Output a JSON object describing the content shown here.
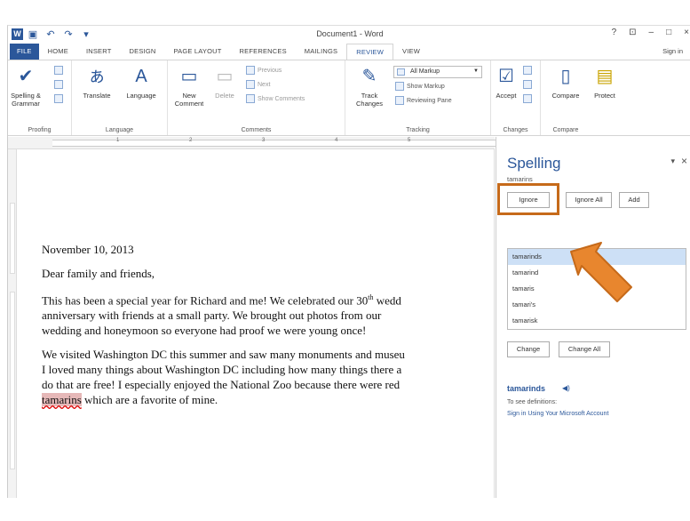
{
  "titlebar": {
    "qat_icons": [
      "save-icon",
      "undo-icon",
      "redo-icon",
      "customize-icon"
    ],
    "doc_title": "Document1 - Word",
    "window_controls": [
      "?",
      "⊡",
      "–",
      "□",
      "×"
    ]
  },
  "tabs": [
    "FILE",
    "HOME",
    "INSERT",
    "DESIGN",
    "PAGE LAYOUT",
    "REFERENCES",
    "MAILINGS",
    "REVIEW",
    "VIEW"
  ],
  "active_tab": "REVIEW",
  "signin": "Sign in",
  "ribbon": {
    "proofing": {
      "label": "Proofing",
      "spelling": "Spelling &",
      "grammar": "Grammar"
    },
    "language": {
      "label": "Language",
      "translate": "Translate",
      "language": "Language"
    },
    "comments": {
      "label": "Comments",
      "new": "New",
      "comment": "Comment",
      "delete": "Delete",
      "previous": "Previous",
      "next": "Next",
      "show_comments": "Show Comments"
    },
    "tracking": {
      "label": "Tracking",
      "track": "Track",
      "changes": "Changes",
      "markup": "All Markup",
      "show_markup": "Show Markup",
      "reviewing_pane": "Reviewing Pane"
    },
    "changes": {
      "label": "Changes",
      "accept": "Accept"
    },
    "compare": {
      "label": "Compare",
      "compare": "Compare",
      "protect": "Protect"
    }
  },
  "ruler_numbers": [
    "1",
    "2",
    "3",
    "4",
    "5"
  ],
  "document": {
    "date": "November 10, 2013",
    "greeting": "Dear family and friends,",
    "para1_line1_pre": "This has been a special year for Richard and me! We celebrated our 30",
    "para1_sup": "th",
    "para1_line1_post": " wedd",
    "para1_line2": "anniversary with friends at a small party.  We brought out photos from our",
    "para1_line3": "wedding and honeymoon so everyone had proof we were young once!",
    "para2_line1": "We visited Washington DC this summer and saw many monuments and museu",
    "para2_line2": "I loved many things about Washington DC including how many things there a",
    "para2_line3": "do that are free!  I especially enjoyed the National Zoo because there were red",
    "para2_misspelled": "tamarins",
    "para2_line4_post": " which are a favorite of mine."
  },
  "spelling_pane": {
    "title": "Spelling",
    "word": "tamarins",
    "ignore": "Ignore",
    "ignore_all": "Ignore All",
    "add": "Add",
    "suggestions": [
      "tamarinds",
      "tamarind",
      "tamaris",
      "tamari's",
      "tamarisk"
    ],
    "selected_index": 0,
    "change": "Change",
    "change_all": "Change All",
    "def_word": "tamarinds",
    "def_label": "To see definitions:",
    "def_link": "Sign in Using Your Microsoft Account"
  },
  "colors": {
    "accent": "#2b579a",
    "callout": "#e8862e",
    "callout_border": "#c66a1a"
  }
}
